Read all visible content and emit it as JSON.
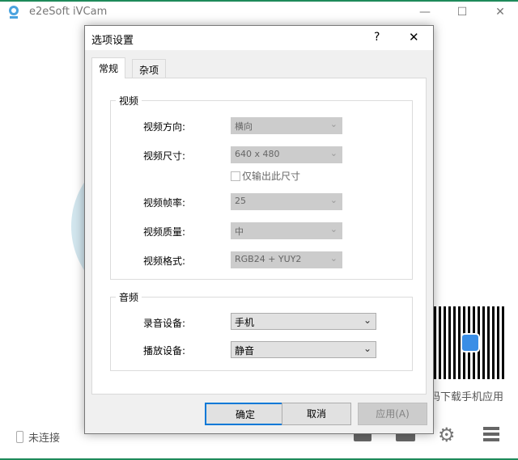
{
  "app": {
    "title": "e2eSoft iVCam",
    "status": "未连接",
    "qr_caption": "码下载手机应用"
  },
  "dialog": {
    "title": "选项设置",
    "help": "?",
    "close": "✕",
    "tabs": [
      "常规",
      "杂项"
    ],
    "video": {
      "label": "视频",
      "rows": [
        {
          "label": "视频方向:",
          "value": "横向"
        },
        {
          "label": "视频尺寸:",
          "value": "640 x 480"
        },
        {
          "label": "视频帧率:",
          "value": "25"
        },
        {
          "label": "视频质量:",
          "value": "中"
        },
        {
          "label": "视频格式:",
          "value": "RGB24 + YUY2"
        }
      ],
      "only_size_label": "仅输出此尺寸"
    },
    "audio": {
      "label": "音频",
      "rows": [
        {
          "label": "录音设备:",
          "value": "手机"
        },
        {
          "label": "播放设备:",
          "value": "静音"
        }
      ]
    },
    "buttons": {
      "ok": "确定",
      "cancel": "取消",
      "apply": "应用(A)"
    }
  },
  "colors": {
    "accent": "#0078d7",
    "brand_line": "#1e8a5a"
  }
}
